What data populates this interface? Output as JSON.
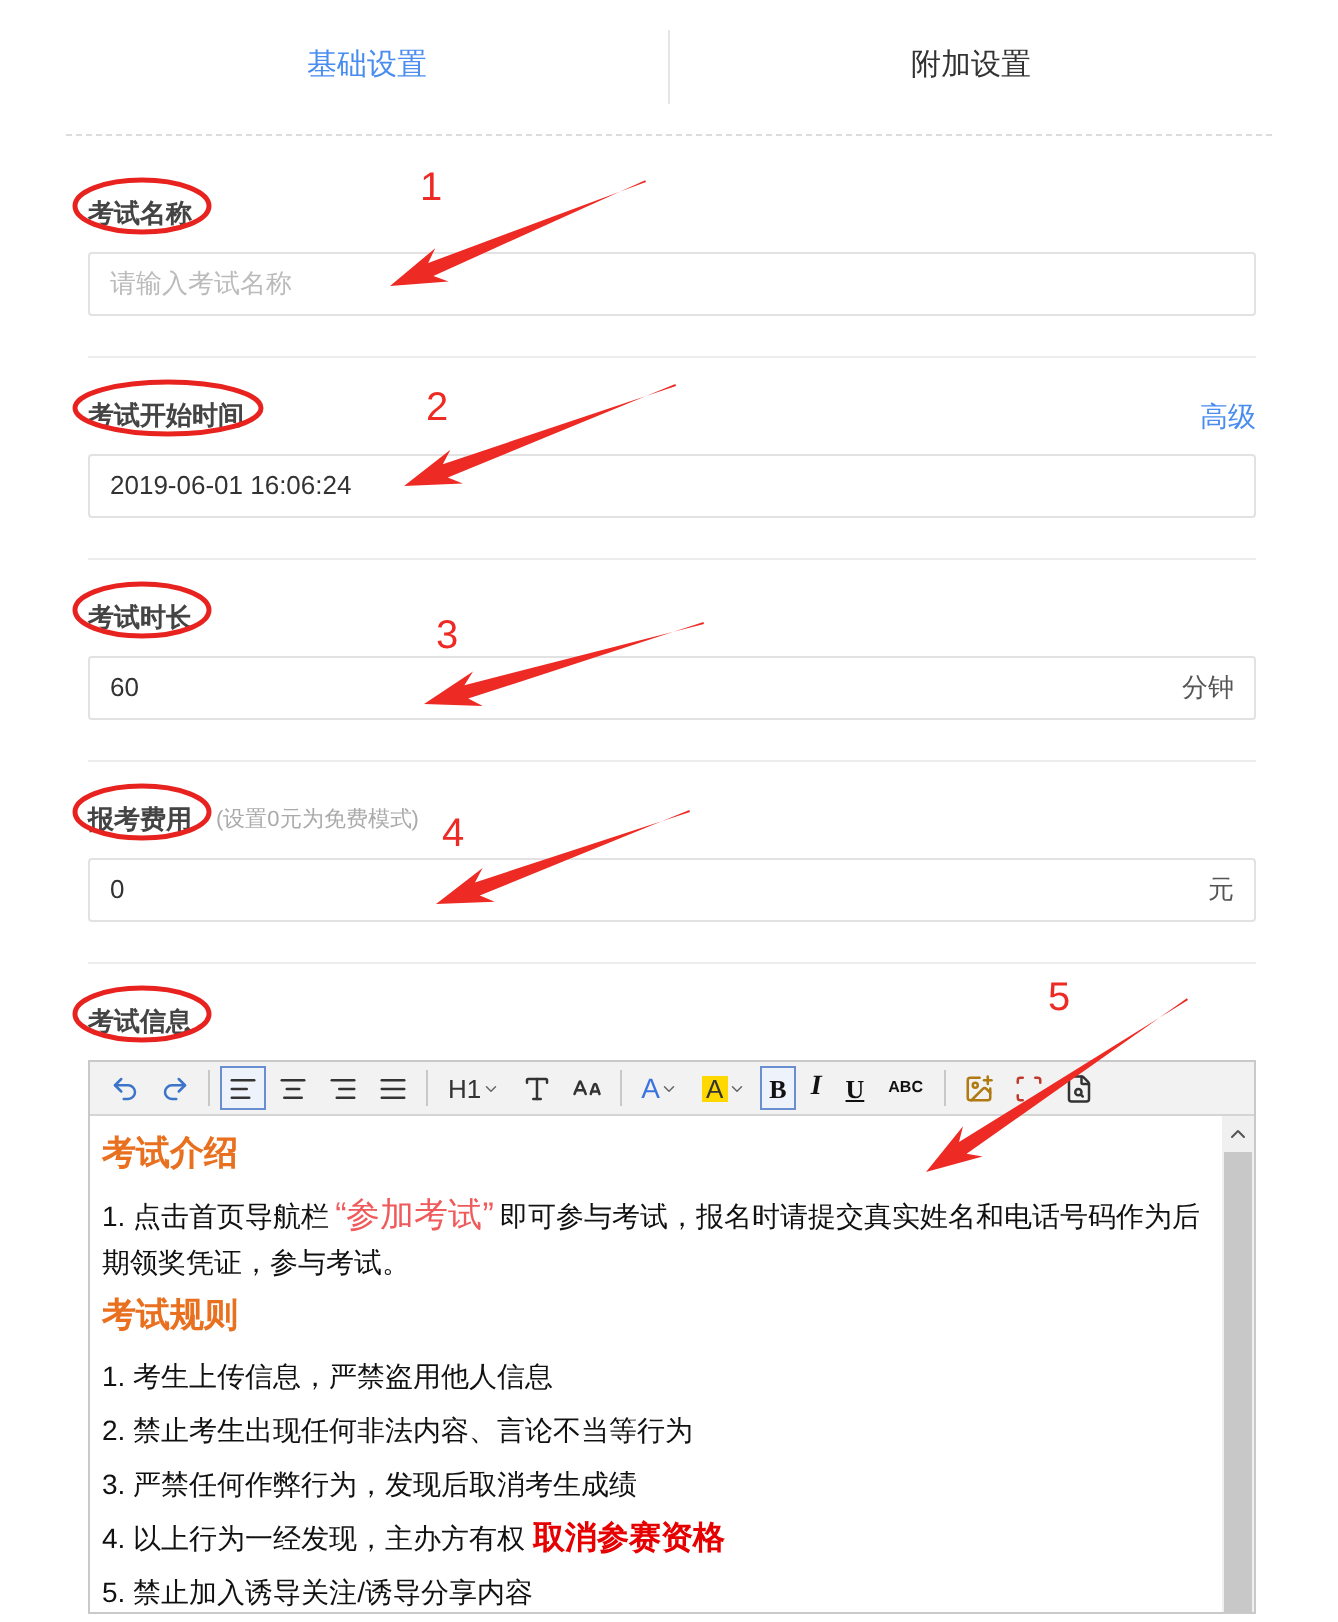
{
  "tabs": [
    {
      "label": "基础设置",
      "selected": true
    },
    {
      "label": "附加设置",
      "selected": false
    }
  ],
  "sections": [
    {
      "kind": "field",
      "label": "考试名称",
      "annotation": "1",
      "input": {
        "placeholder": "请输入考试名称"
      }
    },
    {
      "kind": "field",
      "label": "考试开始时间",
      "annotation": "2",
      "link": "高级",
      "input": {
        "value": "2019-06-01 16:06:24"
      }
    },
    {
      "kind": "field",
      "label": "考试时长",
      "annotation": "3",
      "input": {
        "value": "60",
        "suffix": "分钟"
      }
    },
    {
      "kind": "field",
      "label": "报考费用",
      "hint": "(设置0元为免费模式)",
      "annotation": "4",
      "input": {
        "value": "0",
        "suffix": "元"
      }
    },
    {
      "kind": "editor",
      "label": "考试信息",
      "annotation": "5",
      "editor": {
        "toolbar": [
          {
            "kind": "undo"
          },
          {
            "kind": "redo"
          },
          {
            "kind": "sep"
          },
          {
            "kind": "align-left",
            "selected": true
          },
          {
            "kind": "align-center",
            "selected": false
          },
          {
            "kind": "align-right",
            "selected": false
          },
          {
            "kind": "align-justify",
            "selected": false
          },
          {
            "kind": "sep"
          },
          {
            "kind": "heading",
            "label": "H1"
          },
          {
            "kind": "font"
          },
          {
            "kind": "size"
          },
          {
            "kind": "sep"
          },
          {
            "kind": "color",
            "label": "A"
          },
          {
            "kind": "highlight",
            "label": "A"
          },
          {
            "kind": "bold",
            "label": "B",
            "selected": true
          },
          {
            "kind": "italic",
            "label": "I",
            "selected": false
          },
          {
            "kind": "underline",
            "label": "U",
            "selected": false
          },
          {
            "kind": "strike",
            "label": "ABC",
            "selected": false
          },
          {
            "kind": "sep"
          },
          {
            "kind": "image"
          },
          {
            "kind": "frame"
          },
          {
            "kind": "preview"
          }
        ],
        "blocks": [
          {
            "kind": "heading",
            "text": "考试介绍"
          },
          {
            "kind": "paragraph",
            "segments": [
              {
                "kind": "plain",
                "text": "1. 点击首页导航栏"
              },
              {
                "kind": "quote",
                "text": "“参加考试”"
              },
              {
                "kind": "plain",
                "text": "即可参与考试，报名时请提交真实姓名和电话号码作为后期领奖凭证，参与考试。"
              }
            ]
          },
          {
            "kind": "heading",
            "text": "考试规则"
          },
          {
            "kind": "paragraph",
            "segments": [
              {
                "kind": "plain",
                "text": "1. 考生上传信息，严禁盗用他人信息"
              }
            ]
          },
          {
            "kind": "paragraph",
            "segments": [
              {
                "kind": "plain",
                "text": "2. 禁止考生出现任何非法内容、言论不当等行为"
              }
            ]
          },
          {
            "kind": "paragraph",
            "segments": [
              {
                "kind": "plain",
                "text": "3. 严禁任何作弊行为，发现后取消考生成绩"
              }
            ]
          },
          {
            "kind": "paragraph",
            "segments": [
              {
                "kind": "plain",
                "text": "4. 以上行为一经发现，主办方有权 "
              },
              {
                "kind": "alert",
                "text": "取消参赛资格"
              }
            ]
          },
          {
            "kind": "paragraph",
            "segments": [
              {
                "kind": "plain",
                "text": "5. 禁止加入诱导关注/诱导分享内容"
              }
            ]
          }
        ]
      }
    }
  ]
}
